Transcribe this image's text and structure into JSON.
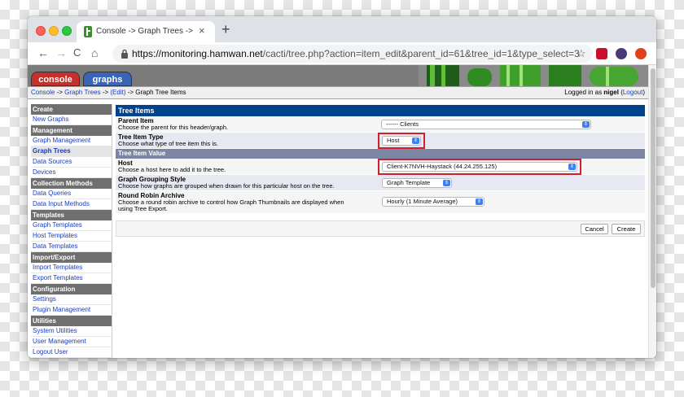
{
  "browser": {
    "tab_title": "Console -> Graph Trees -> (Ed",
    "tab_close": "×",
    "new_tab": "+",
    "url_host": "https://monitoring.hamwan.net",
    "url_path": "/cacti/tree.php?action=item_edit&parent_id=61&tree_id=1&type_select=3",
    "back_icon": "←",
    "forward_icon": "→",
    "reload_icon": "C",
    "home_icon": "⌂",
    "star_icon": "☆"
  },
  "cacti_tabs": {
    "console": "console",
    "graphs": "graphs"
  },
  "breadcrumb": {
    "console": "Console",
    "sep1": " -> ",
    "graph_trees": "Graph Trees",
    "sep2": " -> ",
    "edit": "(Edit)",
    "sep3": " -> ",
    "current": "Graph Tree Items"
  },
  "login": {
    "prefix": "Logged in as ",
    "user": "nigel",
    "open": " (",
    "logout": "Logout",
    "close": ")"
  },
  "sidebar": {
    "sections": [
      {
        "title": "Create",
        "items": [
          "New Graphs"
        ]
      },
      {
        "title": "Management",
        "items": [
          "Graph Management",
          "Graph Trees",
          "Data Sources",
          "Devices"
        ]
      },
      {
        "title": "Collection Methods",
        "items": [
          "Data Queries",
          "Data Input Methods"
        ]
      },
      {
        "title": "Templates",
        "items": [
          "Graph Templates",
          "Host Templates",
          "Data Templates"
        ]
      },
      {
        "title": "Import/Export",
        "items": [
          "Import Templates",
          "Export Templates"
        ]
      },
      {
        "title": "Configuration",
        "items": [
          "Settings",
          "Plugin Management"
        ]
      },
      {
        "title": "Utilities",
        "items": [
          "System Utilities",
          "User Management",
          "Logout User"
        ]
      }
    ]
  },
  "form": {
    "title": "Tree Items",
    "parent_item": {
      "label": "Parent Item",
      "desc": "Choose the parent for this header/graph.",
      "value": "------ Clients"
    },
    "tree_item_type": {
      "label": "Tree Item Type",
      "desc": "Choose what type of tree item this is.",
      "value": "Host"
    },
    "value_header": "Tree Item Value",
    "host": {
      "label": "Host",
      "desc": "Choose a host here to add it to the tree.",
      "value": "Client-K7NVH-Haystack (44.24.255.125)"
    },
    "grouping": {
      "label": "Graph Grouping Style",
      "desc": "Choose how graphs are grouped when drawn for this particular host on the tree.",
      "value": "Graph Template"
    },
    "rra": {
      "label": "Round Robin Archive",
      "desc1": "Choose a round robin archive to control how Graph Thumbnails are displayed when",
      "desc2": "using Tree Export.",
      "value": "Hourly (1 Minute Average)"
    },
    "cancel": "Cancel",
    "create": "Create",
    "select_arrow": "⇕"
  }
}
